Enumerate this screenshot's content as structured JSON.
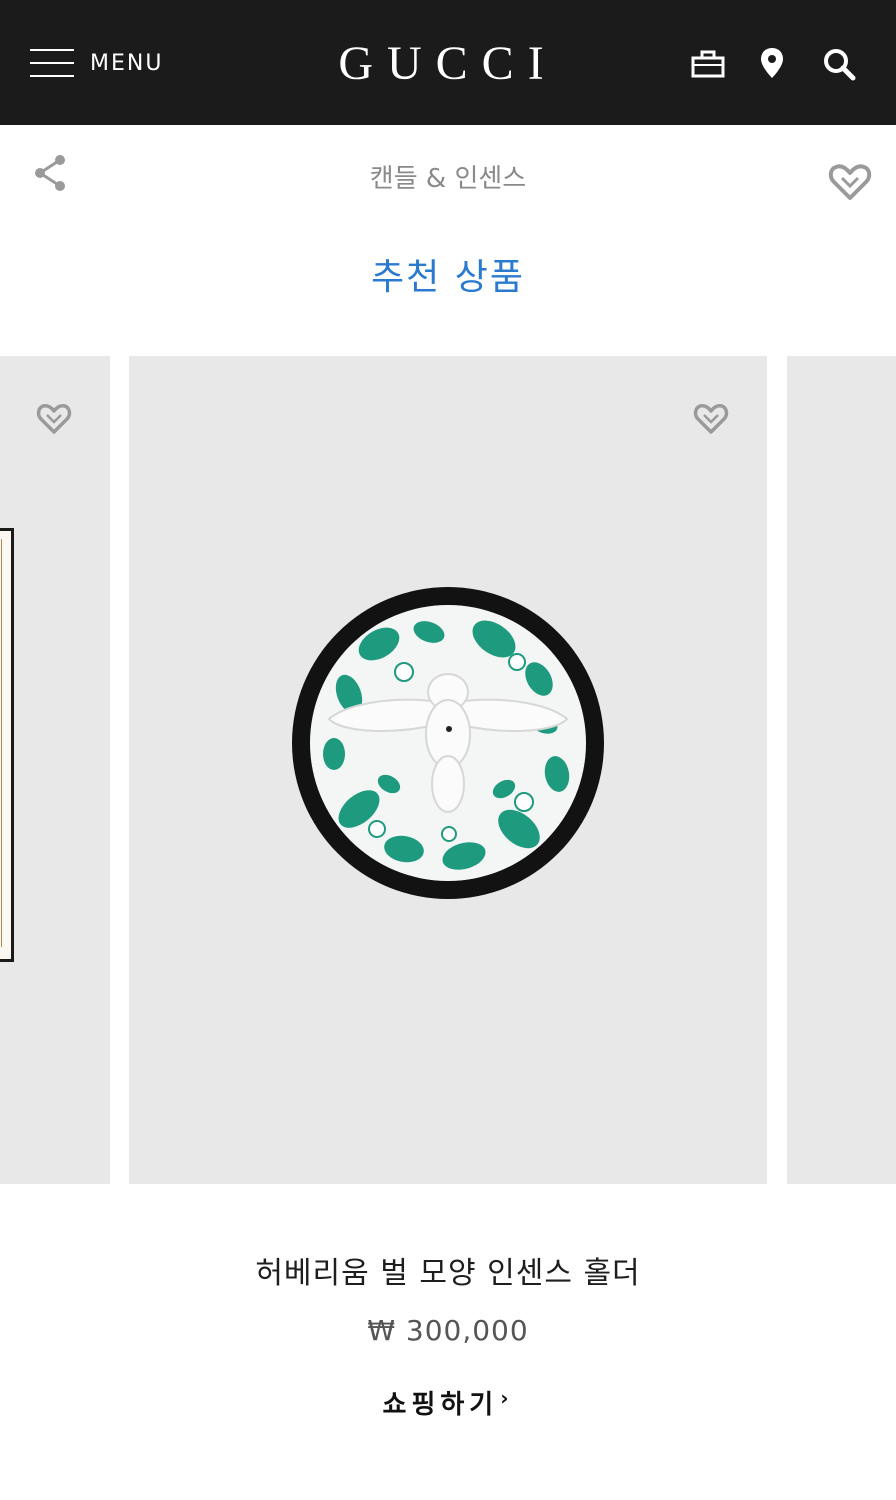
{
  "header": {
    "menu_label": "MENU",
    "logo_text": "GUCCI",
    "icons": [
      "shopping-bag-icon",
      "location-pin-icon",
      "search-icon"
    ],
    "background_color": "#1b1b1b"
  },
  "subheader": {
    "category": "캔들 & 인센스",
    "icons": [
      "share-icon",
      "heart-icon"
    ]
  },
  "section": {
    "title": "추천 상품",
    "title_color": "#2a7bcf"
  },
  "carousel": {
    "card_background": "#e8e8e8",
    "current_product": {
      "name": "허베리움 벌 모양 인센스 홀더",
      "price": "₩ 300,000",
      "cta_label": "쇼핑하기",
      "cta_chevron": "›"
    }
  }
}
